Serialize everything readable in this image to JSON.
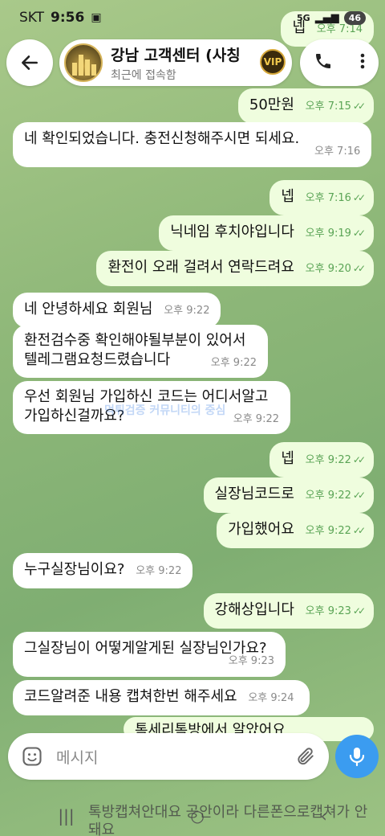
{
  "status_bar": {
    "carrier": "SKT",
    "time": "9:56",
    "network": "5G",
    "battery": "46"
  },
  "header": {
    "title": "강남 고객센터 (사칭",
    "status": "최근에 접속함",
    "badge": "VIP"
  },
  "messages": [
    {
      "side": "out",
      "text": "넵",
      "time": "오후 7:14"
    },
    {
      "side": "out",
      "text": "50만원",
      "time": "오후 7:15"
    },
    {
      "side": "in",
      "text": "네 확인되었습니다. 충전신청해주시면 되세요.",
      "time": "오후 7:16"
    },
    {
      "side": "out",
      "text": "넵",
      "time": "오후 7:16"
    },
    {
      "side": "out",
      "text": "닉네임 후치야입니다",
      "time": "오후 9:19"
    },
    {
      "side": "out",
      "text": "환전이 오래 걸려서 연락드려요",
      "time": "오후 9:20"
    },
    {
      "side": "in",
      "text": "네 안녕하세요 회원님",
      "time": "오후 9:22"
    },
    {
      "side": "in",
      "line1": "환전검수중 확인해야될부분이 있어서",
      "line2": "텔레그램요청드렸습니다",
      "time": "오후 9:22"
    },
    {
      "side": "in",
      "line1": "우선 회원님 가입하신 코드는 어디서알고",
      "line2": "가입하신걸까요?",
      "time": "오후 9:22"
    },
    {
      "side": "out",
      "text": "넵",
      "time": "오후 9:22"
    },
    {
      "side": "out",
      "text": "실장님코드로",
      "time": "오후 9:22"
    },
    {
      "side": "out",
      "text": "가입했어요",
      "time": "오후 9:22"
    },
    {
      "side": "in",
      "text": "누구실장님이요?",
      "time": "오후 9:22"
    },
    {
      "side": "out",
      "text": "강해상입니다",
      "time": "오후 9:23"
    },
    {
      "side": "in",
      "text": "그실장님이 어떻게알게된 실장님인가요?",
      "time": "오후 9:23"
    },
    {
      "side": "in",
      "text": "코드알려준 내용 캡쳐한번 해주세요",
      "time": "오후 9:24"
    },
    {
      "side": "out",
      "text": "톡세리톡방에서 알았어요",
      "time": ""
    }
  ],
  "composer": {
    "placeholder": "메시지"
  },
  "watermark": "먹튀검증 커뮤니티의 중심",
  "overlay_text": "톡방캡쳐안대요 공안이라 다른폰으로캡쳐가 안돼요"
}
